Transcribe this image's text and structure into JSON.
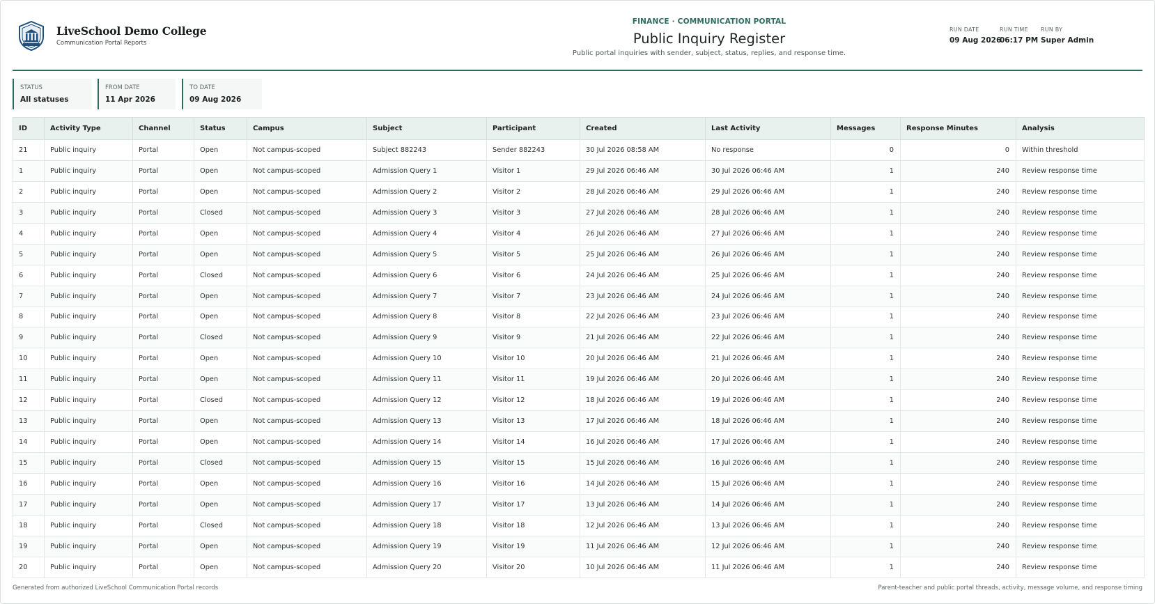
{
  "header": {
    "college_name": "LiveSchool Demo College",
    "college_sub": "Communication Portal Reports",
    "kicker": "FINANCE · COMMUNICATION PORTAL",
    "title": "Public Inquiry Register",
    "subtitle": "Public portal inquiries with sender, subject, status, replies, and response time.",
    "run": [
      {
        "label": "RUN DATE",
        "value": "09 Aug 2026"
      },
      {
        "label": "RUN TIME",
        "value": "06:17 PM"
      },
      {
        "label": "RUN BY",
        "value": "Super Admin"
      }
    ]
  },
  "filters": [
    {
      "label": "STATUS",
      "value": "All statuses"
    },
    {
      "label": "FROM DATE",
      "value": "11 Apr 2026"
    },
    {
      "label": "TO DATE",
      "value": "09 Aug 2026"
    }
  ],
  "table": {
    "columns": [
      "ID",
      "Activity Type",
      "Channel",
      "Status",
      "Campus",
      "Subject",
      "Participant",
      "Created",
      "Last Activity",
      "Messages",
      "Response Minutes",
      "Analysis"
    ],
    "rows": [
      [
        "21",
        "Public inquiry",
        "Portal",
        "Open",
        "Not campus-scoped",
        "Subject 882243",
        "Sender 882243",
        "30 Jul 2026 08:58 AM",
        "No response",
        "0",
        "0",
        "Within threshold"
      ],
      [
        "1",
        "Public inquiry",
        "Portal",
        "Open",
        "Not campus-scoped",
        "Admission Query 1",
        "Visitor 1",
        "29 Jul 2026 06:46 AM",
        "30 Jul 2026 06:46 AM",
        "1",
        "240",
        "Review response time"
      ],
      [
        "2",
        "Public inquiry",
        "Portal",
        "Open",
        "Not campus-scoped",
        "Admission Query 2",
        "Visitor 2",
        "28 Jul 2026 06:46 AM",
        "29 Jul 2026 06:46 AM",
        "1",
        "240",
        "Review response time"
      ],
      [
        "3",
        "Public inquiry",
        "Portal",
        "Closed",
        "Not campus-scoped",
        "Admission Query 3",
        "Visitor 3",
        "27 Jul 2026 06:46 AM",
        "28 Jul 2026 06:46 AM",
        "1",
        "240",
        "Review response time"
      ],
      [
        "4",
        "Public inquiry",
        "Portal",
        "Open",
        "Not campus-scoped",
        "Admission Query 4",
        "Visitor 4",
        "26 Jul 2026 06:46 AM",
        "27 Jul 2026 06:46 AM",
        "1",
        "240",
        "Review response time"
      ],
      [
        "5",
        "Public inquiry",
        "Portal",
        "Open",
        "Not campus-scoped",
        "Admission Query 5",
        "Visitor 5",
        "25 Jul 2026 06:46 AM",
        "26 Jul 2026 06:46 AM",
        "1",
        "240",
        "Review response time"
      ],
      [
        "6",
        "Public inquiry",
        "Portal",
        "Closed",
        "Not campus-scoped",
        "Admission Query 6",
        "Visitor 6",
        "24 Jul 2026 06:46 AM",
        "25 Jul 2026 06:46 AM",
        "1",
        "240",
        "Review response time"
      ],
      [
        "7",
        "Public inquiry",
        "Portal",
        "Open",
        "Not campus-scoped",
        "Admission Query 7",
        "Visitor 7",
        "23 Jul 2026 06:46 AM",
        "24 Jul 2026 06:46 AM",
        "1",
        "240",
        "Review response time"
      ],
      [
        "8",
        "Public inquiry",
        "Portal",
        "Open",
        "Not campus-scoped",
        "Admission Query 8",
        "Visitor 8",
        "22 Jul 2026 06:46 AM",
        "23 Jul 2026 06:46 AM",
        "1",
        "240",
        "Review response time"
      ],
      [
        "9",
        "Public inquiry",
        "Portal",
        "Closed",
        "Not campus-scoped",
        "Admission Query 9",
        "Visitor 9",
        "21 Jul 2026 06:46 AM",
        "22 Jul 2026 06:46 AM",
        "1",
        "240",
        "Review response time"
      ],
      [
        "10",
        "Public inquiry",
        "Portal",
        "Open",
        "Not campus-scoped",
        "Admission Query 10",
        "Visitor 10",
        "20 Jul 2026 06:46 AM",
        "21 Jul 2026 06:46 AM",
        "1",
        "240",
        "Review response time"
      ],
      [
        "11",
        "Public inquiry",
        "Portal",
        "Open",
        "Not campus-scoped",
        "Admission Query 11",
        "Visitor 11",
        "19 Jul 2026 06:46 AM",
        "20 Jul 2026 06:46 AM",
        "1",
        "240",
        "Review response time"
      ],
      [
        "12",
        "Public inquiry",
        "Portal",
        "Closed",
        "Not campus-scoped",
        "Admission Query 12",
        "Visitor 12",
        "18 Jul 2026 06:46 AM",
        "19 Jul 2026 06:46 AM",
        "1",
        "240",
        "Review response time"
      ],
      [
        "13",
        "Public inquiry",
        "Portal",
        "Open",
        "Not campus-scoped",
        "Admission Query 13",
        "Visitor 13",
        "17 Jul 2026 06:46 AM",
        "18 Jul 2026 06:46 AM",
        "1",
        "240",
        "Review response time"
      ],
      [
        "14",
        "Public inquiry",
        "Portal",
        "Open",
        "Not campus-scoped",
        "Admission Query 14",
        "Visitor 14",
        "16 Jul 2026 06:46 AM",
        "17 Jul 2026 06:46 AM",
        "1",
        "240",
        "Review response time"
      ],
      [
        "15",
        "Public inquiry",
        "Portal",
        "Closed",
        "Not campus-scoped",
        "Admission Query 15",
        "Visitor 15",
        "15 Jul 2026 06:46 AM",
        "16 Jul 2026 06:46 AM",
        "1",
        "240",
        "Review response time"
      ],
      [
        "16",
        "Public inquiry",
        "Portal",
        "Open",
        "Not campus-scoped",
        "Admission Query 16",
        "Visitor 16",
        "14 Jul 2026 06:46 AM",
        "15 Jul 2026 06:46 AM",
        "1",
        "240",
        "Review response time"
      ],
      [
        "17",
        "Public inquiry",
        "Portal",
        "Open",
        "Not campus-scoped",
        "Admission Query 17",
        "Visitor 17",
        "13 Jul 2026 06:46 AM",
        "14 Jul 2026 06:46 AM",
        "1",
        "240",
        "Review response time"
      ],
      [
        "18",
        "Public inquiry",
        "Portal",
        "Closed",
        "Not campus-scoped",
        "Admission Query 18",
        "Visitor 18",
        "12 Jul 2026 06:46 AM",
        "13 Jul 2026 06:46 AM",
        "1",
        "240",
        "Review response time"
      ],
      [
        "19",
        "Public inquiry",
        "Portal",
        "Open",
        "Not campus-scoped",
        "Admission Query 19",
        "Visitor 19",
        "11 Jul 2026 06:46 AM",
        "12 Jul 2026 06:46 AM",
        "1",
        "240",
        "Review response time"
      ],
      [
        "20",
        "Public inquiry",
        "Portal",
        "Open",
        "Not campus-scoped",
        "Admission Query 20",
        "Visitor 20",
        "10 Jul 2026 06:46 AM",
        "11 Jul 2026 06:46 AM",
        "1",
        "240",
        "Review response time"
      ]
    ]
  },
  "footer": {
    "left": "Generated from authorized LiveSchool Communication Portal records",
    "right": "Parent-teacher and public portal threads, activity, message volume, and response timing"
  },
  "theme": {
    "accent": "#2c6b5e",
    "header_bg": "#e9f1ee"
  },
  "icons": {
    "logo": "college-crest-icon"
  }
}
